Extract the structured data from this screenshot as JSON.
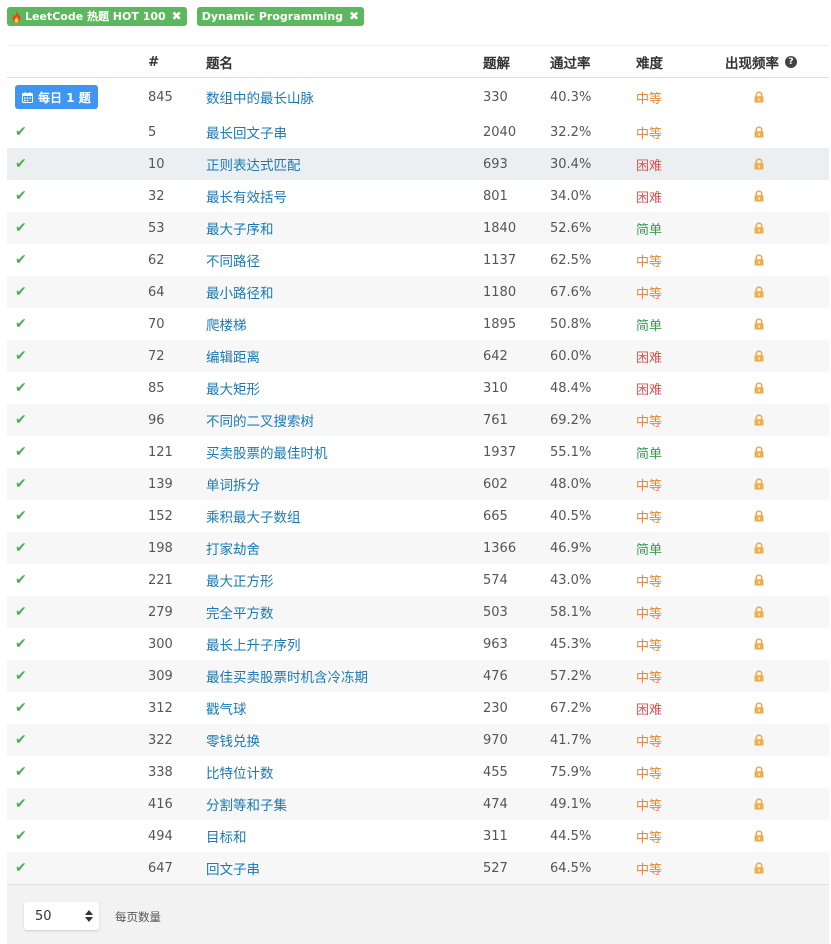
{
  "tags": [
    {
      "label": "LeetCode 热题 HOT 100",
      "has_flame": true
    },
    {
      "label": "Dynamic Programming",
      "has_flame": false
    }
  ],
  "tag_close_glyph": "✖",
  "header": {
    "id": "#",
    "title": "题名",
    "solutions": "题解",
    "acceptance": "通过率",
    "difficulty": "难度",
    "frequency": "出现频率",
    "help_glyph": "?"
  },
  "daily_badge": "每日 1 题",
  "check_glyph": "✔",
  "icons": {
    "solved": "check-icon",
    "locked": "lock-icon",
    "calendar": "calendar-icon",
    "flame": "flame-icon",
    "help": "question-circle-icon"
  },
  "colors": {
    "medium": "#e08a3c",
    "hard": "#d9534f",
    "easy": "#3d9a53",
    "tag": "#5cb85c",
    "daily": "#3e96f2",
    "lock": "#f0ad4e"
  },
  "problems": [
    {
      "id": "845",
      "title": "数组中的最长山脉",
      "solutions": "330",
      "acceptance": "40.3%",
      "difficulty": "中等",
      "level": "medium",
      "daily": true
    },
    {
      "id": "5",
      "title": "最长回文子串",
      "solutions": "2040",
      "acceptance": "32.2%",
      "difficulty": "中等",
      "level": "medium"
    },
    {
      "id": "10",
      "title": "正则表达式匹配",
      "solutions": "693",
      "acceptance": "30.4%",
      "difficulty": "困难",
      "level": "hard"
    },
    {
      "id": "32",
      "title": "最长有效括号",
      "solutions": "801",
      "acceptance": "34.0%",
      "difficulty": "困难",
      "level": "hard"
    },
    {
      "id": "53",
      "title": "最大子序和",
      "solutions": "1840",
      "acceptance": "52.6%",
      "difficulty": "简单",
      "level": "easy"
    },
    {
      "id": "62",
      "title": "不同路径",
      "solutions": "1137",
      "acceptance": "62.5%",
      "difficulty": "中等",
      "level": "medium"
    },
    {
      "id": "64",
      "title": "最小路径和",
      "solutions": "1180",
      "acceptance": "67.6%",
      "difficulty": "中等",
      "level": "medium"
    },
    {
      "id": "70",
      "title": "爬楼梯",
      "solutions": "1895",
      "acceptance": "50.8%",
      "difficulty": "简单",
      "level": "easy"
    },
    {
      "id": "72",
      "title": "编辑距离",
      "solutions": "642",
      "acceptance": "60.0%",
      "difficulty": "困难",
      "level": "hard"
    },
    {
      "id": "85",
      "title": "最大矩形",
      "solutions": "310",
      "acceptance": "48.4%",
      "difficulty": "困难",
      "level": "hard"
    },
    {
      "id": "96",
      "title": "不同的二叉搜索树",
      "solutions": "761",
      "acceptance": "69.2%",
      "difficulty": "中等",
      "level": "medium"
    },
    {
      "id": "121",
      "title": "买卖股票的最佳时机",
      "solutions": "1937",
      "acceptance": "55.1%",
      "difficulty": "简单",
      "level": "easy"
    },
    {
      "id": "139",
      "title": "单词拆分",
      "solutions": "602",
      "acceptance": "48.0%",
      "difficulty": "中等",
      "level": "medium"
    },
    {
      "id": "152",
      "title": "乘积最大子数组",
      "solutions": "665",
      "acceptance": "40.5%",
      "difficulty": "中等",
      "level": "medium"
    },
    {
      "id": "198",
      "title": "打家劫舍",
      "solutions": "1366",
      "acceptance": "46.9%",
      "difficulty": "简单",
      "level": "easy"
    },
    {
      "id": "221",
      "title": "最大正方形",
      "solutions": "574",
      "acceptance": "43.0%",
      "difficulty": "中等",
      "level": "medium"
    },
    {
      "id": "279",
      "title": "完全平方数",
      "solutions": "503",
      "acceptance": "58.1%",
      "difficulty": "中等",
      "level": "medium"
    },
    {
      "id": "300",
      "title": "最长上升子序列",
      "solutions": "963",
      "acceptance": "45.3%",
      "difficulty": "中等",
      "level": "medium"
    },
    {
      "id": "309",
      "title": "最佳买卖股票时机含冷冻期",
      "solutions": "476",
      "acceptance": "57.2%",
      "difficulty": "中等",
      "level": "medium"
    },
    {
      "id": "312",
      "title": "戳气球",
      "solutions": "230",
      "acceptance": "67.2%",
      "difficulty": "困难",
      "level": "hard"
    },
    {
      "id": "322",
      "title": "零钱兑换",
      "solutions": "970",
      "acceptance": "41.7%",
      "difficulty": "中等",
      "level": "medium"
    },
    {
      "id": "338",
      "title": "比特位计数",
      "solutions": "455",
      "acceptance": "75.9%",
      "difficulty": "中等",
      "level": "medium"
    },
    {
      "id": "416",
      "title": "分割等和子集",
      "solutions": "474",
      "acceptance": "49.1%",
      "difficulty": "中等",
      "level": "medium"
    },
    {
      "id": "494",
      "title": "目标和",
      "solutions": "311",
      "acceptance": "44.5%",
      "difficulty": "中等",
      "level": "medium"
    },
    {
      "id": "647",
      "title": "回文子串",
      "solutions": "527",
      "acceptance": "64.5%",
      "difficulty": "中等",
      "level": "medium"
    }
  ],
  "footer": {
    "page_size": "50",
    "page_size_label": "每页数量"
  }
}
